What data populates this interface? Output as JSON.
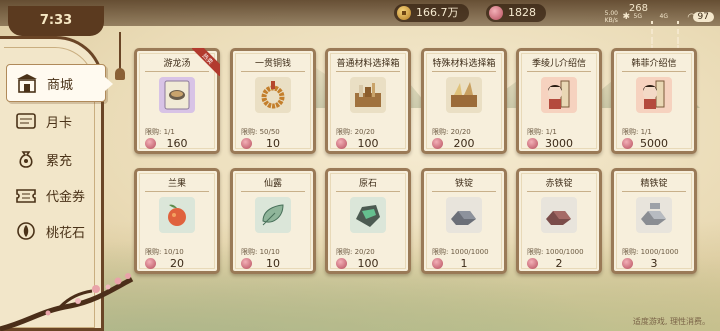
{
  "status": {
    "time": "7:33",
    "network_speed": "5.00\nKB/s",
    "network_type": "5G",
    "network_type_2": "4G",
    "battery": "97",
    "extra_value": "268"
  },
  "currencies": {
    "coins": "166.7万",
    "blossoms": "1828"
  },
  "sidebar": {
    "items": [
      {
        "label": "商城",
        "icon": "shop-building-icon"
      },
      {
        "label": "月卡",
        "icon": "monthly-card-icon"
      },
      {
        "label": "累充",
        "icon": "money-bag-icon"
      },
      {
        "label": "代金券",
        "icon": "voucher-icon"
      },
      {
        "label": "桃花石",
        "icon": "peach-stone-icon"
      }
    ]
  },
  "shop": {
    "items": [
      {
        "title": "游龙汤",
        "limit": "限购: 1/1",
        "price": "160",
        "hot": true,
        "hot_label": "热卖",
        "img_bg": "#d8c3e6",
        "icon": "soup-bowl-icon"
      },
      {
        "title": "一贯铜钱",
        "limit": "限购: 50/50",
        "price": "10",
        "img_bg": "#eadfc4",
        "icon": "coin-string-icon"
      },
      {
        "title": "普通材料选择箱",
        "limit": "限购: 20/20",
        "price": "100",
        "img_bg": "#eadfc4",
        "icon": "material-box-icon"
      },
      {
        "title": "特殊材料选择箱",
        "limit": "限购: 20/20",
        "price": "200",
        "img_bg": "#eadfc4",
        "icon": "special-box-icon"
      },
      {
        "title": "季绫儿介绍信",
        "limit": "限购: 1/1",
        "price": "3000",
        "img_bg": "#f6d2bf",
        "icon": "character-letter-icon"
      },
      {
        "title": "韩菲介绍信",
        "limit": "限购: 1/1",
        "price": "5000",
        "img_bg": "#f6d2bf",
        "icon": "character-letter-icon"
      },
      {
        "title": "兰果",
        "limit": "限购: 10/10",
        "price": "20",
        "img_bg": "#dbe6d9",
        "icon": "fruit-icon"
      },
      {
        "title": "仙露",
        "limit": "限购: 10/10",
        "price": "10",
        "img_bg": "#dbe6d9",
        "icon": "leaf-dew-icon"
      },
      {
        "title": "原石",
        "limit": "限购: 20/20",
        "price": "100",
        "img_bg": "#dbe6d9",
        "icon": "jade-stone-icon"
      },
      {
        "title": "铁锭",
        "limit": "限购: 1000/1000",
        "price": "1",
        "img_bg": "#e8e4dc",
        "icon": "iron-ingot-icon"
      },
      {
        "title": "赤铁锭",
        "limit": "限购: 1000/1000",
        "price": "2",
        "img_bg": "#e8e4dc",
        "icon": "red-iron-ingot-icon"
      },
      {
        "title": "精铁锭",
        "limit": "限购: 1000/1000",
        "price": "3",
        "img_bg": "#e8e4dc",
        "icon": "fine-iron-ingot-icon"
      }
    ]
  },
  "footer": "适度游戏, 理性消费。",
  "colors": {
    "frame": "#6a4526",
    "card_border": "#9a7a57",
    "panel_bg": "#f2e6c9"
  }
}
